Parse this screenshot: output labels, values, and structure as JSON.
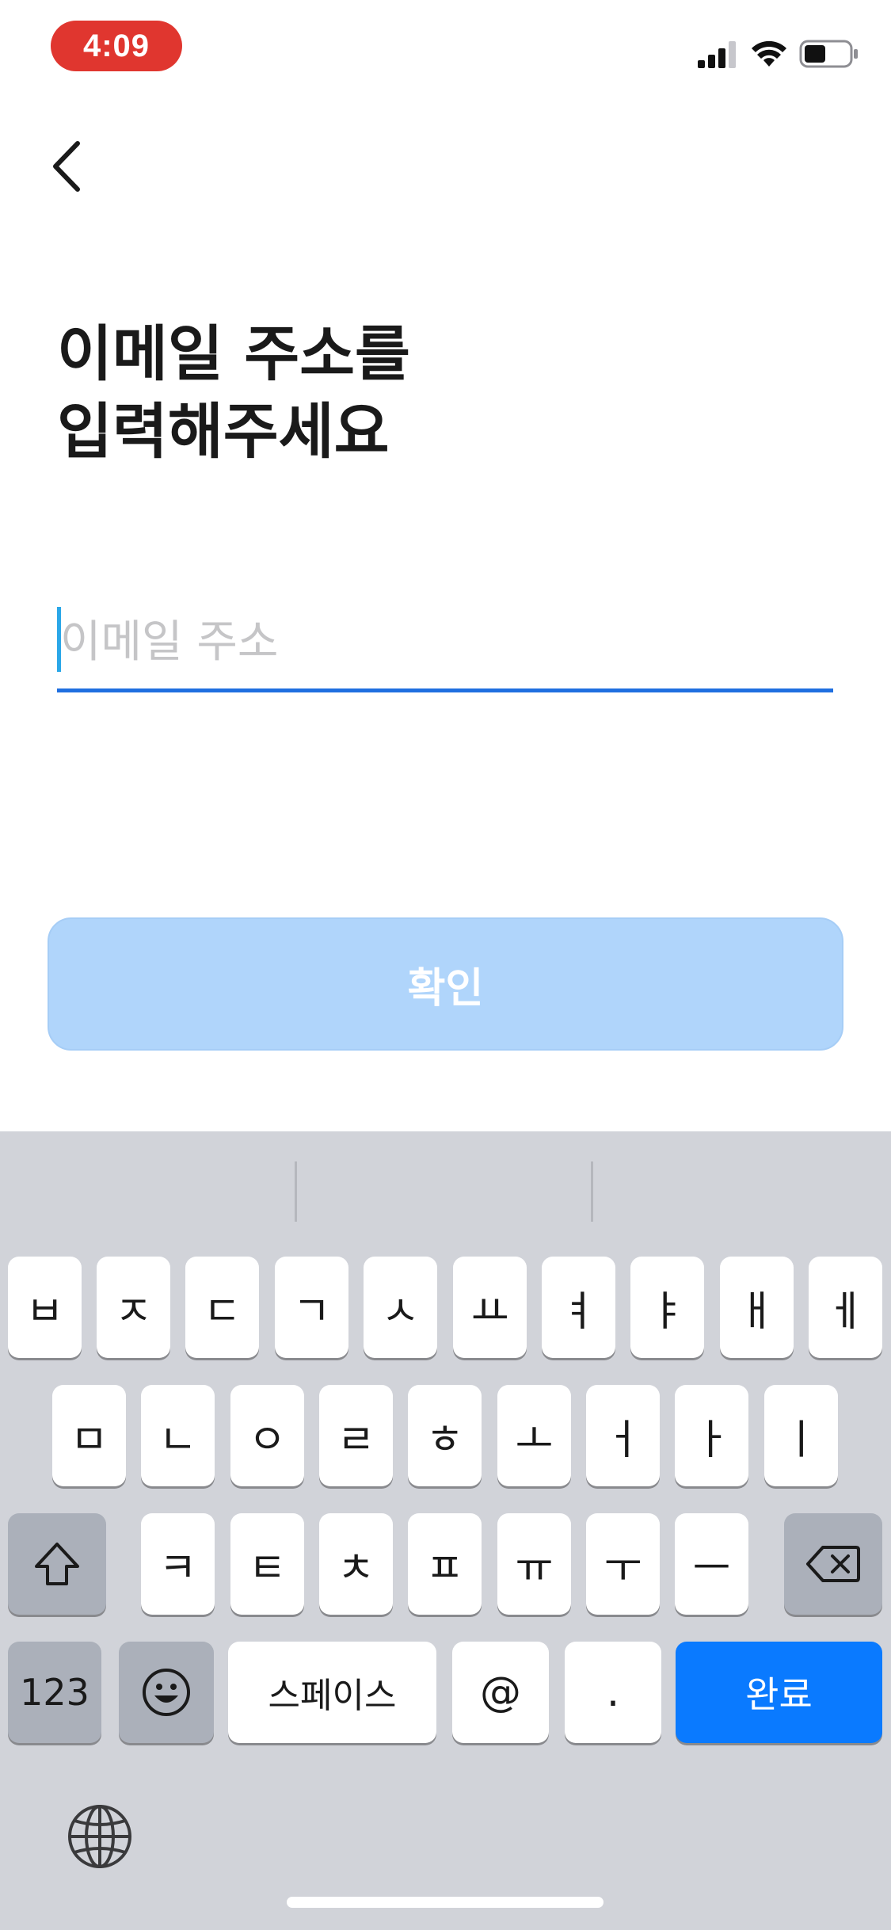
{
  "status_bar": {
    "time": "4:09"
  },
  "page": {
    "title_line1": "이메일 주소를",
    "title_line2": "입력해주세요"
  },
  "email": {
    "placeholder": "이메일 주소",
    "value": ""
  },
  "confirm_button": {
    "label": "확인"
  },
  "keyboard": {
    "row1": [
      "ㅂ",
      "ㅈ",
      "ㄷ",
      "ㄱ",
      "ㅅ",
      "ㅛ",
      "ㅕ",
      "ㅑ",
      "ㅐ",
      "ㅔ"
    ],
    "row2": [
      "ㅁ",
      "ㄴ",
      "ㅇ",
      "ㄹ",
      "ㅎ",
      "ㅗ",
      "ㅓ",
      "ㅏ",
      "ㅣ"
    ],
    "row3": [
      "ㅋ",
      "ㅌ",
      "ㅊ",
      "ㅍ",
      "ㅠ",
      "ㅜ",
      "ㅡ"
    ],
    "numbers_key": "123",
    "space_key": "스페이스",
    "at_key": "@",
    "dot_key": ".",
    "done_key": "완료"
  },
  "colors": {
    "status_time_bg": "#e0362f",
    "input_underline": "#1f6fe0",
    "confirm_disabled": "#b0d5fb",
    "done_key": "#0a7aff"
  }
}
